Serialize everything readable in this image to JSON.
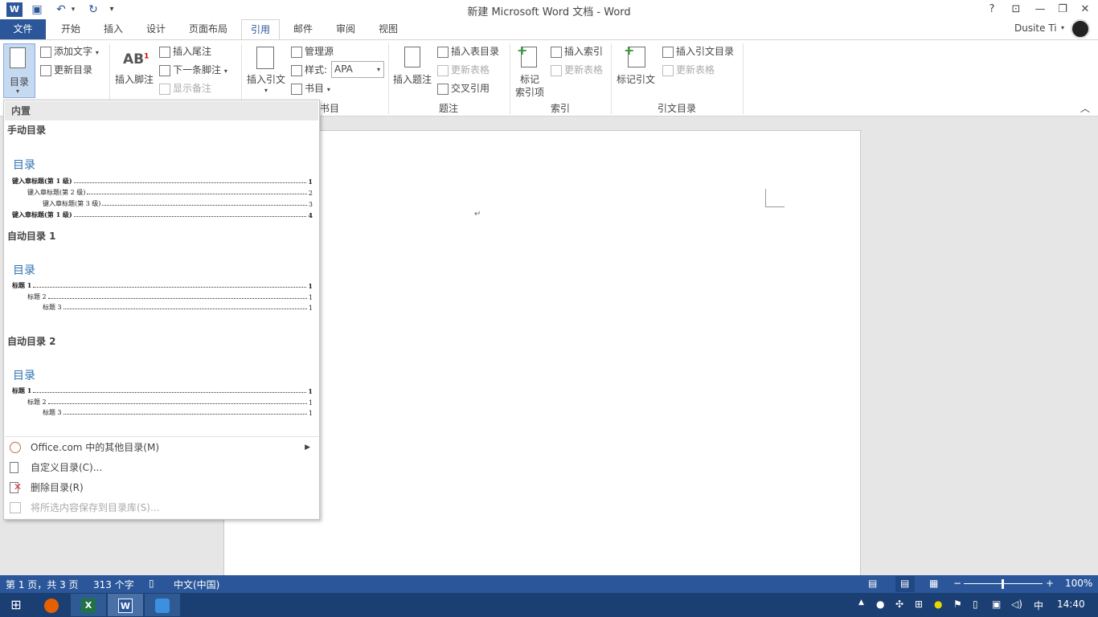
{
  "window": {
    "title": "新建 Microsoft Word 文档 - Word",
    "help": "?",
    "user": "Dusite Ti"
  },
  "tabs": [
    {
      "label": "文件"
    },
    {
      "label": "开始"
    },
    {
      "label": "插入"
    },
    {
      "label": "设计"
    },
    {
      "label": "页面布局"
    },
    {
      "label": "引用"
    },
    {
      "label": "邮件"
    },
    {
      "label": "审阅"
    },
    {
      "label": "视图"
    }
  ],
  "ribbon": {
    "toc": {
      "label": "目录",
      "add_text": "添加文字",
      "update_toc": "更新目录"
    },
    "footnotes": {
      "insert_footnote": "插入脚注",
      "insert_endnote": "插入尾注",
      "next_footnote": "下一条脚注",
      "show_notes": "显示备注"
    },
    "citations": {
      "insert_citation": "插入引文",
      "manage_sources": "管理源",
      "style_label": "样式:",
      "style_value": "APA",
      "bibliography": "书目",
      "group": "书目"
    },
    "captions": {
      "insert_caption": "插入题注",
      "insert_table_of_figures": "插入表目录",
      "update_table": "更新表格",
      "cross_reference": "交叉引用",
      "group": "题注"
    },
    "index": {
      "mark_entry_1": "标记",
      "mark_entry_2": "索引项",
      "insert_index": "插入索引",
      "update_index": "更新表格",
      "group": "索引"
    },
    "authorities": {
      "mark_citation": "标记引文",
      "insert_toa": "插入引文目录",
      "update_table": "更新表格",
      "group": "引文目录"
    }
  },
  "dropdown": {
    "section": "内置",
    "galleries": [
      {
        "name": "手动目录",
        "heading": "目录",
        "lines": [
          {
            "text": "键入章标题(第 1 级)",
            "page": "1",
            "level": 1
          },
          {
            "text": "键入章标题(第 2 级)",
            "page": "2",
            "level": 2
          },
          {
            "text": "键入章标题(第 3 级)",
            "page": "3",
            "level": 3
          },
          {
            "text": "键入章标题(第 1 级)",
            "page": "4",
            "level": 1
          }
        ]
      },
      {
        "name": "自动目录 1",
        "heading": "目录",
        "lines": [
          {
            "text": "标题 1",
            "page": "1",
            "level": 1
          },
          {
            "text": "标题 2",
            "page": "1",
            "level": 2
          },
          {
            "text": "标题 3",
            "page": "1",
            "level": 3
          }
        ]
      },
      {
        "name": "自动目录 2",
        "heading": "目录",
        "lines": [
          {
            "text": "标题 1",
            "page": "1",
            "level": 1
          },
          {
            "text": "标题 2",
            "page": "1",
            "level": 2
          },
          {
            "text": "标题 3",
            "page": "1",
            "level": 3
          }
        ]
      }
    ],
    "menu": [
      {
        "label": "Office.com 中的其他目录(M)",
        "submenu": true,
        "disabled": false
      },
      {
        "label": "自定义目录(C)...",
        "disabled": false
      },
      {
        "label": "删除目录(R)",
        "disabled": false
      },
      {
        "label": "将所选内容保存到目录库(S)...",
        "disabled": true
      }
    ]
  },
  "document": {
    "paragraph_mark": "↵"
  },
  "status": {
    "page": "第 1 页，共 3 页",
    "words": "313 个字",
    "language": "中文(中国)",
    "zoom": "100%"
  },
  "taskbar": {
    "ime": "中",
    "time": "14:40"
  },
  "colors": {
    "accent": "#2b579a",
    "toc_heading": "#2e74b5",
    "taskbar": "#1c3f73"
  }
}
